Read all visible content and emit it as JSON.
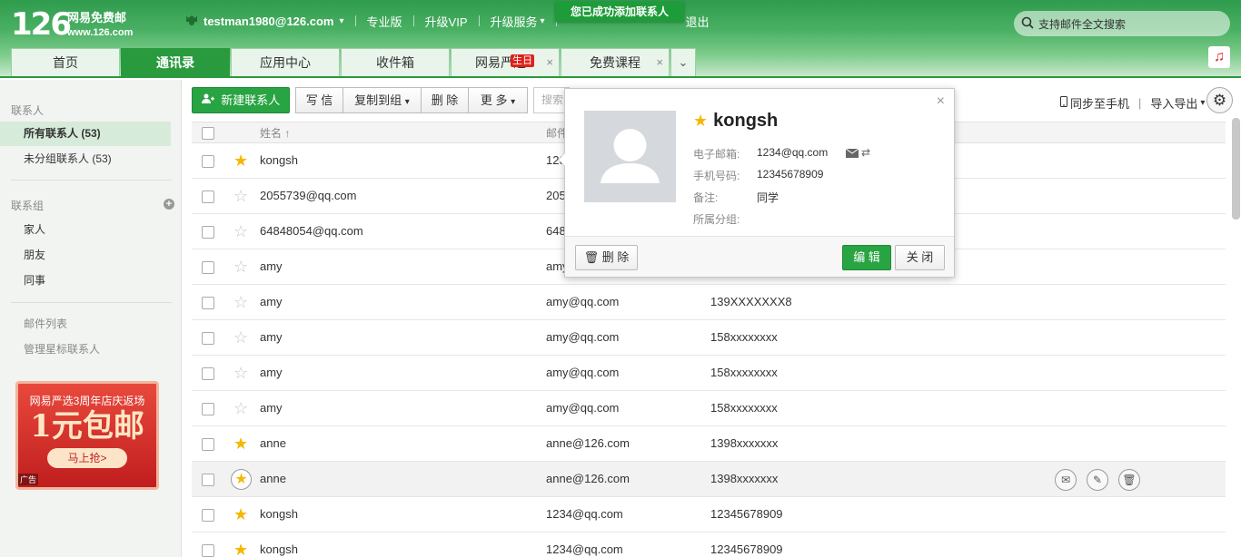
{
  "header": {
    "logo_num": "126",
    "logo_name": "网易免费邮",
    "logo_domain": "www.126.com",
    "user": "testman1980@126.com",
    "nav": [
      "专业版",
      "升级VIP",
      "升级服务"
    ],
    "nav_extra": "退出",
    "toast": "您已成功添加联系人",
    "search_placeholder": "支持邮件全文搜索"
  },
  "tabs": [
    {
      "label": "首页",
      "active": false,
      "closable": false
    },
    {
      "label": "通讯录",
      "active": true,
      "closable": false
    },
    {
      "label": "应用中心",
      "active": false,
      "closable": false
    },
    {
      "label": "收件箱",
      "active": false,
      "closable": false
    },
    {
      "label": "网易严选",
      "active": false,
      "closable": true,
      "badge": "生日"
    },
    {
      "label": "免费课程",
      "active": false,
      "closable": true
    }
  ],
  "sidebar": {
    "contacts_title": "联系人",
    "all_contacts": "所有联系人 (53)",
    "ungrouped": "未分组联系人 (53)",
    "groups_title": "联系组",
    "groups": [
      "家人",
      "朋友",
      "同事"
    ],
    "mail_list": "邮件列表",
    "manage_star": "管理星标联系人",
    "ad": {
      "line1": "网易严选3周年店庆返场",
      "line2": "1元包邮",
      "button": "马上抢>",
      "tag": "广告"
    }
  },
  "toolbar": {
    "new_contact": "新建联系人",
    "write": "写 信",
    "copy_to_group": "复制到组",
    "delete": "删 除",
    "more": "更 多",
    "search_placeholder": "搜索",
    "sync_phone": "同步至手机",
    "import_export": "导入导出"
  },
  "table": {
    "col_name": "姓名 ↑",
    "col_email": "邮件",
    "rows": [
      {
        "starred": true,
        "name": "kongsh",
        "email": "1234@qq.com",
        "phone": "12345678909"
      },
      {
        "starred": false,
        "name": "2055739@qq.com",
        "email": "2055739@qq.com",
        "phone": ""
      },
      {
        "starred": false,
        "name": "64848054@qq.com",
        "email": "64848054@qq.com",
        "phone": ""
      },
      {
        "starred": false,
        "name": "amy",
        "email": "amy@qq.com",
        "phone": ""
      },
      {
        "starred": false,
        "name": "amy",
        "email": "amy@qq.com",
        "phone": "139XXXXXXX8"
      },
      {
        "starred": false,
        "name": "amy",
        "email": "amy@qq.com",
        "phone": "158xxxxxxxx"
      },
      {
        "starred": false,
        "name": "amy",
        "email": "amy@qq.com",
        "phone": "158xxxxxxxx"
      },
      {
        "starred": false,
        "name": "amy",
        "email": "amy@qq.com",
        "phone": "158xxxxxxxx"
      },
      {
        "starred": true,
        "name": "anne",
        "email": "anne@126.com",
        "phone": "1398xxxxxxx"
      },
      {
        "starred": true,
        "name": "anne",
        "email": "anne@126.com",
        "phone": "1398xxxxxxx"
      },
      {
        "starred": true,
        "name": "kongsh",
        "email": "1234@qq.com",
        "phone": "12345678909"
      },
      {
        "starred": true,
        "name": "kongsh",
        "email": "1234@qq.com",
        "phone": "12345678909"
      }
    ]
  },
  "popup": {
    "name": "kongsh",
    "email_label": "电子邮箱:",
    "email": "1234@qq.com",
    "phone_label": "手机号码:",
    "phone": "12345678909",
    "note_label": "备注:",
    "note": "同学",
    "group_label": "所属分组:",
    "delete": "删 除",
    "edit": "编 辑",
    "close": "关 闭"
  },
  "colors": {
    "brand_green": "#2a9a3e",
    "star": "#f5b800",
    "badge_red": "#e0201b"
  }
}
